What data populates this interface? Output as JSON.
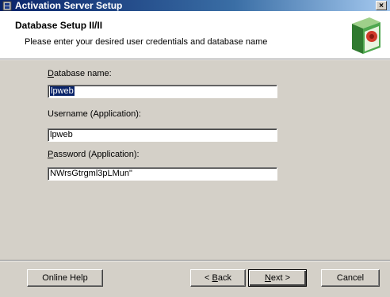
{
  "window": {
    "title": "Activation Server Setup",
    "close_glyph": "×"
  },
  "header": {
    "title": "Database Setup II/II",
    "subtitle": "Please enter your desired user credentials and database name"
  },
  "form": {
    "db_name": {
      "label_accel": "D",
      "label_rest": "atabase name:",
      "value": "lpweb"
    },
    "username": {
      "label": "Username (Application):",
      "value": "lpweb"
    },
    "password": {
      "label_accel": "P",
      "label_rest": "assword (Application):",
      "value": "NWrsGtrgml3pLMun\""
    }
  },
  "buttons": {
    "online_help": "Online Help",
    "back_prefix": "< ",
    "back_accel": "B",
    "back_rest": "ack",
    "next_accel": "N",
    "next_rest": "ext >",
    "cancel": "Cancel"
  },
  "colors": {
    "titlebar_start": "#0a246a",
    "selection": "#0a246a",
    "dialog_bg": "#d4d0c8"
  }
}
